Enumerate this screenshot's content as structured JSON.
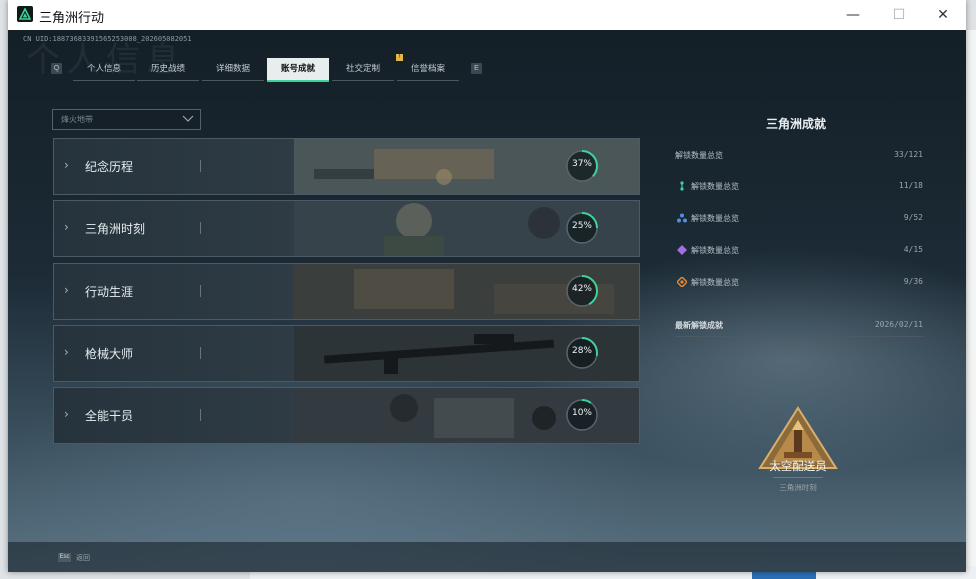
{
  "window": {
    "title": "三角洲行动",
    "minimize": "—",
    "maximize": "☐",
    "close": "✕"
  },
  "game": {
    "uid": "CN UID:18873683391565253008_202605082051",
    "background_title": "个人信息",
    "tabs": {
      "prev_key": "Q",
      "next_key": "E",
      "items": [
        "个人信息",
        "历史战绩",
        "详细数据",
        "账号成就",
        "社交定制",
        "信誉档案"
      ],
      "active_index": 3,
      "badge_on_index": 4,
      "badge_text": "!"
    },
    "filter": {
      "label": "烽火地带"
    },
    "categories": [
      {
        "label": "纪念历程",
        "percent_text": "37%",
        "progress": 0.37
      },
      {
        "label": "三角洲时刻",
        "percent_text": "25%",
        "progress": 0.25
      },
      {
        "label": "行动生涯",
        "percent_text": "42%",
        "progress": 0.42
      },
      {
        "label": "枪械大师",
        "percent_text": "28%",
        "progress": 0.28
      },
      {
        "label": "全能干员",
        "percent_text": "10%",
        "progress": 0.1
      }
    ],
    "panel": {
      "title": "三角洲成就",
      "total": {
        "label": "解锁数量总览",
        "value": "33/121"
      },
      "tiers": [
        {
          "label": "解锁数量总览",
          "value": "11/18",
          "icon": "green-tier-icon",
          "color": "#3fd39a"
        },
        {
          "label": "解锁数量总览",
          "value": "9/52",
          "icon": "blue-tier-icon",
          "color": "#4f8fe0"
        },
        {
          "label": "解锁数量总览",
          "value": "4/15",
          "icon": "purple-tier-icon",
          "color": "#a46de0"
        },
        {
          "label": "解锁数量总览",
          "value": "9/36",
          "icon": "orange-tier-icon",
          "color": "#e08a3a"
        }
      ],
      "recent": {
        "heading": "最新解锁成就",
        "date": "2026/02/11",
        "name": "太空配送员",
        "category": "三角洲时刻"
      }
    },
    "footer": {
      "esc_key": "Esc",
      "back_label": "返回"
    }
  },
  "accent_color": "#3fd39a"
}
